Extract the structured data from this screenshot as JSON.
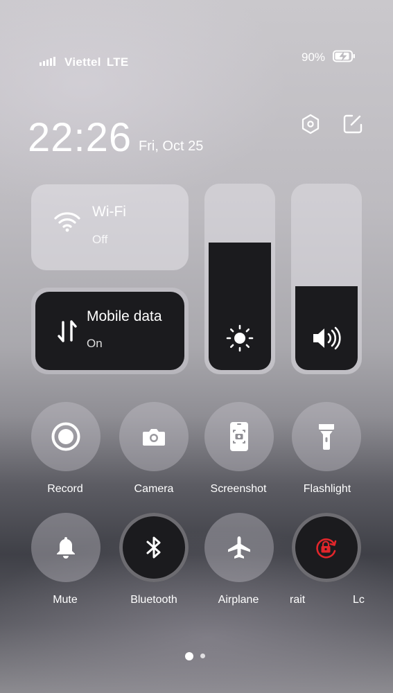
{
  "status_bar": {
    "carrier": "Viettel",
    "network": "LTE",
    "battery_percent": "90%"
  },
  "clock": {
    "time": "22:26",
    "date": "Fri, Oct 25"
  },
  "tiles": {
    "wifi": {
      "title": "Wi-Fi",
      "status": "Off"
    },
    "mobile_data": {
      "title": "Mobile data",
      "status": "On"
    }
  },
  "sliders": {
    "brightness_level": 0.7,
    "volume_level": 0.46
  },
  "quick_toggles": [
    {
      "label": "Record",
      "icon": "record-icon",
      "active": false
    },
    {
      "label": "Camera",
      "icon": "camera-icon",
      "active": false
    },
    {
      "label": "Screenshot",
      "icon": "screenshot-icon",
      "active": false
    },
    {
      "label": "Flashlight",
      "icon": "flashlight-icon",
      "active": false
    },
    {
      "label": "Mute",
      "icon": "bell-icon",
      "active": false
    },
    {
      "label": "Bluetooth",
      "icon": "bluetooth-icon",
      "active": true
    },
    {
      "label": "Airplane",
      "icon": "airplane-icon",
      "active": false
    },
    {
      "label": "rait",
      "icon": "rotation-lock-icon",
      "active": true
    },
    {
      "label": "Lc",
      "icon": "",
      "active": false
    }
  ],
  "colors": {
    "active_tile": "#1b1b1e",
    "rotation_lock": "#e2262b"
  },
  "pager": {
    "pages": 2,
    "current": 1
  }
}
